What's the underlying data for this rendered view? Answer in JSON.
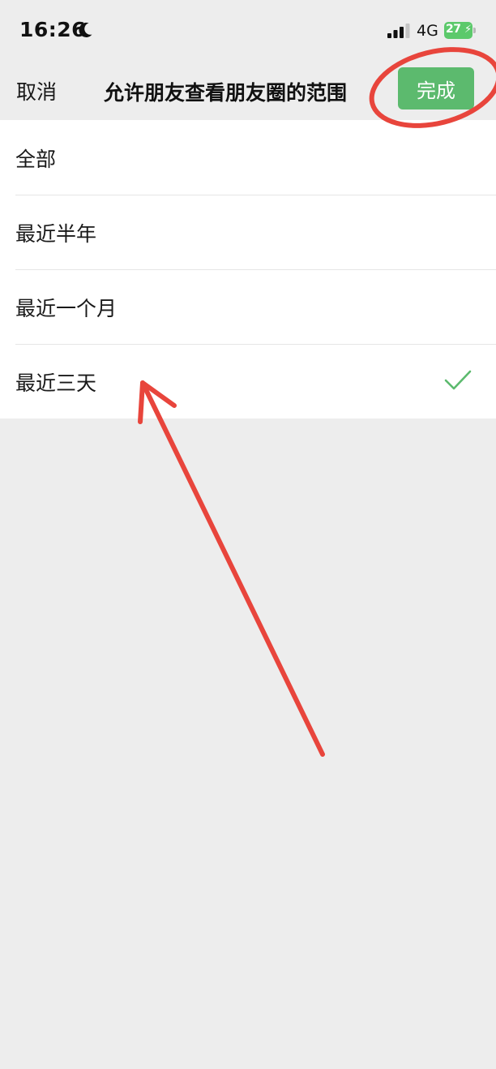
{
  "status_bar": {
    "time": "16:26",
    "network": "4G",
    "battery_level": "27",
    "icons": [
      "moon-icon",
      "signal-icon",
      "battery-icon",
      "charging-bolt-icon"
    ]
  },
  "nav": {
    "cancel_label": "取消",
    "title": "允许朋友查看朋友圈的范围",
    "done_label": "完成"
  },
  "options": [
    {
      "label": "全部",
      "selected": false
    },
    {
      "label": "最近半年",
      "selected": false
    },
    {
      "label": "最近一个月",
      "selected": false
    },
    {
      "label": "最近三天",
      "selected": true
    }
  ],
  "colors": {
    "background": "#ededed",
    "list_background": "#ffffff",
    "accent_green": "#5cba6e",
    "check_green": "#5cba6e",
    "annotation_red": "#e8453c",
    "battery_green": "#5cc96b"
  },
  "annotations": {
    "done_button_circled": true,
    "arrow_points_to": "最近三天"
  }
}
